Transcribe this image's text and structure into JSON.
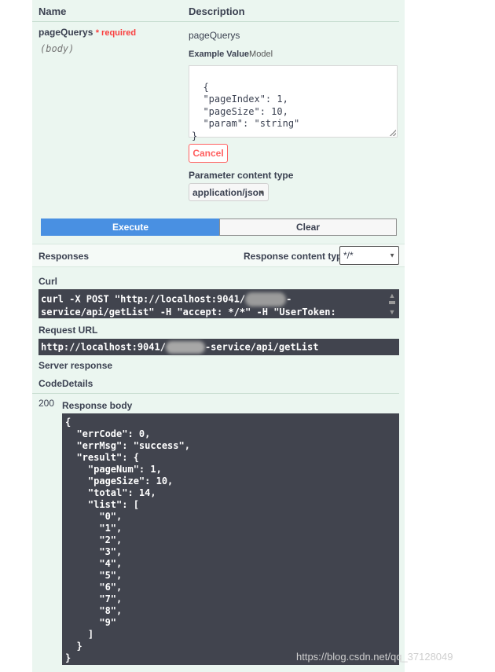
{
  "params": {
    "col_name": "Name",
    "col_description": "Description",
    "param_name": "pageQuerys",
    "required_label": "* required",
    "param_in": "(body)",
    "param_desc": "pageQuerys",
    "example_value_label": "Example Value",
    "model_label": "Model",
    "textarea_value": "{\n  \"pageIndex\": 1,\n  \"pageSize\": 10,\n  \"param\": \"string\"\n}",
    "cancel_label": "Cancel",
    "content_type_label": "Parameter content type",
    "content_type_value": "application/json"
  },
  "actions": {
    "execute_label": "Execute",
    "clear_label": "Clear"
  },
  "responses": {
    "title": "Responses",
    "content_type_label": "Response content type",
    "content_type_value": "*/*",
    "curl_label": "Curl",
    "curl_line1_a": "curl -X POST \"http://localhost:9041/",
    "curl_line1_b": "-",
    "curl_line2": "service/api/getList\" -H \"accept: */*\" -H \"UserToken:",
    "request_url_label": "Request URL",
    "request_url_a": "http://localhost:9041/",
    "request_url_b": "-service/api/getList",
    "server_response_label": "Server response",
    "code_label": "Code",
    "details_label": "Details",
    "status_code": "200",
    "body_label": "Response body",
    "body_text": "{\n  \"errCode\": 0,\n  \"errMsg\": \"success\",\n  \"result\": {\n    \"pageNum\": 1,\n    \"pageSize\": 10,\n    \"total\": 14,\n    \"list\": [\n      \"0\",\n      \"1\",\n      \"2\",\n      \"3\",\n      \"4\",\n      \"5\",\n      \"6\",\n      \"7\",\n      \"8\",\n      \"9\"\n    ]\n  }\n}"
  },
  "watermark": "https://blog.csdn.net/qq_37128049",
  "icons": {
    "caret": "chevron-down-icon",
    "scroll_up": "arrow-up-icon",
    "scroll_down": "arrow-down-icon"
  }
}
